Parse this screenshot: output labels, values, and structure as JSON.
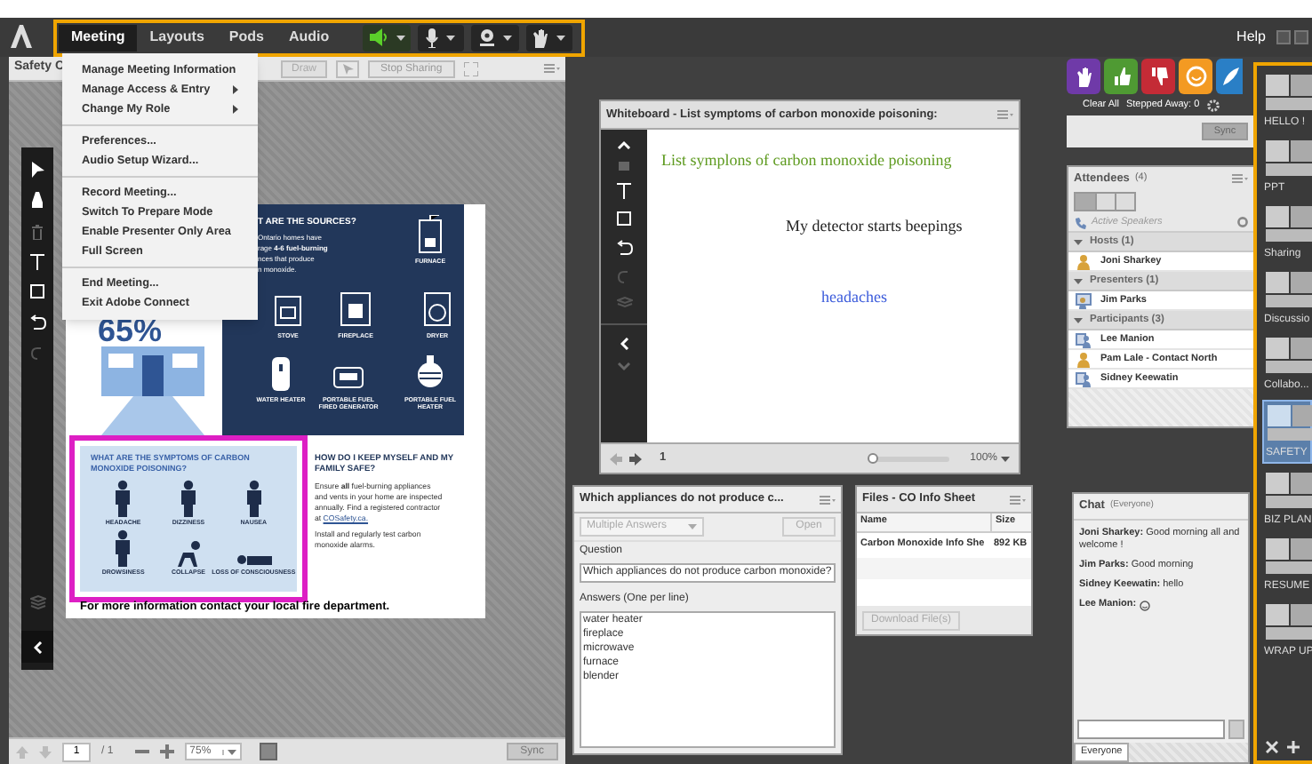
{
  "app_bar": {
    "menus": [
      {
        "label": "Meeting",
        "selected": true
      },
      {
        "label": "Layouts",
        "selected": false
      },
      {
        "label": "Pods",
        "selected": false
      },
      {
        "label": "Audio",
        "selected": false
      }
    ],
    "status_buttons": [
      {
        "kind": "speaker",
        "on": true
      },
      {
        "kind": "microphone",
        "on": false
      },
      {
        "kind": "webcam",
        "on": false
      },
      {
        "kind": "hand",
        "on": false
      }
    ],
    "help": "Help"
  },
  "meeting_menu": [
    [
      {
        "label": "Manage Meeting Information",
        "submenu": false
      },
      {
        "label": "Manage Access & Entry",
        "submenu": true
      },
      {
        "label": "Change My Role",
        "submenu": true
      }
    ],
    [
      {
        "label": "Preferences...",
        "submenu": false
      },
      {
        "label": "Audio Setup Wizard...",
        "submenu": false
      }
    ],
    [
      {
        "label": "Record Meeting...",
        "submenu": false
      },
      {
        "label": "Switch To Prepare Mode",
        "submenu": false
      },
      {
        "label": "Enable Presenter Only Area",
        "submenu": false
      },
      {
        "label": "Full Screen",
        "submenu": false
      }
    ],
    [
      {
        "label": "End Meeting...",
        "submenu": false
      },
      {
        "label": "Exit Adobe Connect",
        "submenu": false
      }
    ]
  ],
  "share_pod": {
    "title": "Safety C",
    "draw_button": "Draw",
    "stop_button": "Stop Sharing",
    "page": "1",
    "page_total": "/ 1",
    "zoom": "75%",
    "sync": "Sync",
    "document": {
      "sources_heading": "T ARE THE SOURCES?",
      "sources_lines": [
        "Ontario homes have",
        "rage **4-6 fuel-burning**",
        "nces that produce",
        "n monoxide."
      ],
      "percent": "65%",
      "sources": [
        {
          "kind": "furnace",
          "label": "FURNACE"
        },
        {
          "kind": "stove",
          "label": "STOVE"
        },
        {
          "kind": "fireplace",
          "label": "FIREPLACE"
        },
        {
          "kind": "dryer",
          "label": "DRYER"
        },
        {
          "kind": "water-heater",
          "label": "WATER HEATER"
        },
        {
          "kind": "generator",
          "label": "PORTABLE FUEL FIRED GENERATOR"
        },
        {
          "kind": "heater",
          "label": "PORTABLE FUEL HEATER"
        }
      ],
      "symptoms_heading": "WHAT ARE THE SYMPTOMS OF CARBON MONOXIDE POISONING?",
      "symptoms": [
        {
          "kind": "standing",
          "label": "HEADACHE"
        },
        {
          "kind": "standing",
          "label": "DIZZINESS"
        },
        {
          "kind": "standing",
          "label": "NAUSEA"
        },
        {
          "kind": "standing",
          "label": "DROWSINESS"
        },
        {
          "kind": "crawling",
          "label": "COLLAPSE"
        },
        {
          "kind": "lying",
          "label": "LOSS OF CONSCIOUSNESS"
        }
      ],
      "safety_heading": "HOW DO I KEEP MYSELF AND MY FAMILY SAFE?",
      "safety_text": "Ensure **all** fuel-burning appliances and vents in your home are inspected annually. Find a registered contractor at",
      "safety_link": "COSafety.ca.",
      "safety_text_2": "Install and regularly test carbon monoxide alarms.",
      "footer": "For more information contact your local fire department."
    }
  },
  "whiteboard": {
    "title": "Whiteboard - List symptoms of carbon monoxide poisoning:",
    "notes": [
      {
        "kind": "heading",
        "text": "List symplons of carbon monoxide poisoning"
      },
      {
        "kind": "note",
        "text": "My detector starts beepings"
      },
      {
        "kind": "answer",
        "text": "headaches"
      }
    ],
    "page": "1",
    "zoom_slider": {
      "level": 0
    },
    "zoom": "100%"
  },
  "poll": {
    "title": "Which appliances do not produce c...",
    "type": "Multiple Answers",
    "open_button": "Open",
    "question_label": "Question",
    "question": "Which appliances do not produce carbon monoxide?",
    "answers_label": "Answers (One per line)",
    "answers": [
      "water heater",
      "fireplace",
      "microwave",
      "furnace",
      "blender"
    ]
  },
  "files": {
    "title": "Files - CO Info Sheet",
    "columns": [
      "Name",
      "Size"
    ],
    "rows": [
      [
        "Carbon Monoxide Info She",
        "892 KB"
      ]
    ],
    "download": "Download File(s)"
  },
  "status_bar": {
    "emoticons": [
      {
        "kind": "hand"
      },
      {
        "kind": "thumbs-up"
      },
      {
        "kind": "thumbs-down"
      },
      {
        "kind": "smile"
      },
      {
        "kind": "feather"
      }
    ],
    "clear_all": "Clear All",
    "stepped_away": "Stepped Away: 0",
    "sync": "Sync"
  },
  "attendees": {
    "title": "Attendees",
    "count": "(4)",
    "active_speakers": "Active Speakers",
    "groups": [
      {
        "label": "Hosts (1)",
        "expanded": true,
        "people": [
          {
            "name": "Joni Sharkey",
            "kind": "host"
          }
        ]
      },
      {
        "label": "Presenters (1)",
        "expanded": true,
        "people": [
          {
            "name": "Jim Parks",
            "kind": "presenter"
          }
        ]
      },
      {
        "label": "Participants (3)",
        "expanded": true,
        "people": [
          {
            "name": "Lee Manion",
            "kind": "participant"
          },
          {
            "name": "Pam Lale - Contact North",
            "kind": "host"
          },
          {
            "name": "Sidney Keewatin",
            "kind": "participant"
          }
        ]
      }
    ]
  },
  "chat": {
    "title": "Chat",
    "audience": "(Everyone)",
    "messages": [
      {
        "text": "**Joni Sharkey:** Good morning all and welcome !",
        "emoticon": false
      },
      {
        "text": "**Jim Parks:** Good morning",
        "emoticon": false
      },
      {
        "text": "**Sidney Keewatin:** hello",
        "emoticon": false
      },
      {
        "text": "**Lee Manion:**",
        "emoticon": true
      }
    ],
    "tab": "Everyone"
  },
  "layouts": [
    {
      "label": "HELLO !",
      "selected": false
    },
    {
      "label": "PPT",
      "selected": false
    },
    {
      "label": "Sharing",
      "selected": false
    },
    {
      "label": "Discussio",
      "selected": false
    },
    {
      "label": "Collabo...",
      "selected": false
    },
    {
      "label": "SAFETY",
      "selected": true
    },
    {
      "label": "BIZ PLAN",
      "selected": false
    },
    {
      "label": "RESUME",
      "selected": false
    },
    {
      "label": "WRAP UP",
      "selected": false
    }
  ]
}
